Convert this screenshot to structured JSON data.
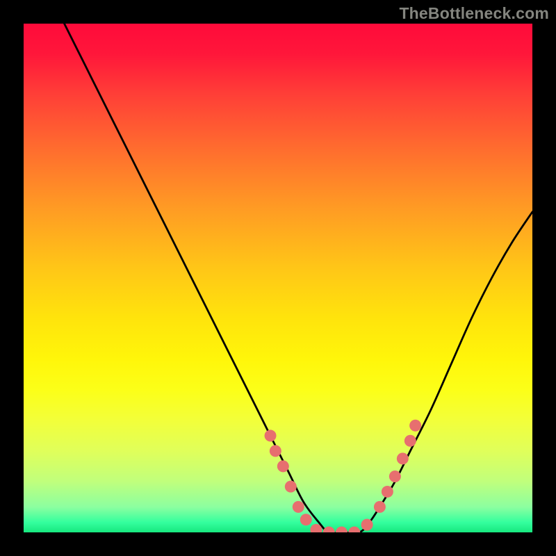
{
  "watermark": "TheBottleneck.com",
  "chart_data": {
    "type": "line",
    "title": "",
    "xlabel": "",
    "ylabel": "",
    "xlim": [
      0,
      100
    ],
    "ylim": [
      0,
      100
    ],
    "grid": false,
    "legend": false,
    "series": [
      {
        "name": "bottleneck-curve",
        "x": [
          8,
          12,
          16,
          20,
          24,
          28,
          32,
          36,
          40,
          44,
          48,
          52,
          55,
          58,
          60,
          63,
          66,
          68,
          70,
          73,
          76,
          80,
          84,
          88,
          92,
          96,
          100
        ],
        "y": [
          100,
          92,
          84,
          76,
          68,
          60,
          52,
          44,
          36,
          28,
          20,
          12,
          6,
          2,
          0,
          0,
          0,
          2,
          5,
          10,
          16,
          24,
          33,
          42,
          50,
          57,
          63
        ]
      }
    ],
    "markers": {
      "name": "highlight-dots",
      "color": "#e76f6f",
      "points": [
        {
          "x": 48.5,
          "y": 19
        },
        {
          "x": 49.5,
          "y": 16
        },
        {
          "x": 51.0,
          "y": 13
        },
        {
          "x": 52.5,
          "y": 9
        },
        {
          "x": 54.0,
          "y": 5
        },
        {
          "x": 55.5,
          "y": 2.5
        },
        {
          "x": 57.5,
          "y": 0.5
        },
        {
          "x": 60.0,
          "y": 0
        },
        {
          "x": 62.5,
          "y": 0
        },
        {
          "x": 65.0,
          "y": 0
        },
        {
          "x": 67.5,
          "y": 1.5
        },
        {
          "x": 70.0,
          "y": 5
        },
        {
          "x": 71.5,
          "y": 8
        },
        {
          "x": 73.0,
          "y": 11
        },
        {
          "x": 74.5,
          "y": 14.5
        },
        {
          "x": 76.0,
          "y": 18
        },
        {
          "x": 77.0,
          "y": 21
        }
      ]
    }
  }
}
